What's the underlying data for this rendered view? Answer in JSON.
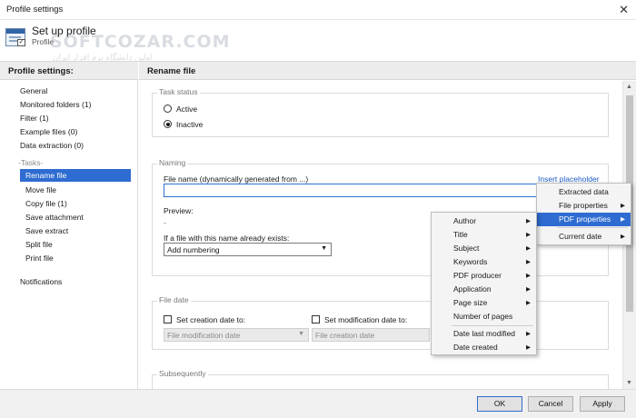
{
  "window": {
    "title": "Profile settings",
    "close_glyph": "✕"
  },
  "header": {
    "title": "Set up profile",
    "subtitle": "Profile",
    "watermark": "SOFTCOZAR.COM",
    "watermark_sub": "اولین دانشگاه نرم افزار ایران"
  },
  "sidebar": {
    "title": "Profile settings:",
    "items": [
      "General",
      "Monitored folders (1)",
      "Filter (1)",
      "Example files (0)",
      "Data extraction (0)"
    ],
    "tasks_label": "-Tasks-",
    "tasks": [
      "Rename file",
      "Move file",
      "Copy file (1)",
      "Save attachment",
      "Save extract",
      "Split file",
      "Print file"
    ],
    "notifications": "Notifications"
  },
  "content": {
    "title": "Rename file",
    "task_status": {
      "label": "Task status",
      "active": "Active",
      "inactive": "Inactive",
      "selected": "Inactive"
    },
    "naming": {
      "label": "Naming",
      "filename_label": "File name (dynamically generated from ...)",
      "filename_value": "",
      "insert_placeholder": "Insert placeholder",
      "preview_label": "Preview:",
      "preview_value": "-",
      "exists_label": "If a file with this name already exists:",
      "exists_value": "Add numbering"
    },
    "file_date": {
      "label": "File date",
      "set_creation": "Set creation date to:",
      "set_modification": "Set modification date to:",
      "creation_source": "File modification date",
      "modification_source": "File creation date"
    },
    "subsequently": {
      "label": "Subsequently"
    }
  },
  "menus": {
    "placeholder": [
      "Extracted data",
      "File properties",
      "PDF properties",
      "Current date"
    ],
    "placeholder_highlight": "PDF properties",
    "pdf_properties": [
      "Author",
      "Title",
      "Subject",
      "Keywords",
      "PDF producer",
      "Application",
      "Page size",
      "Number of pages",
      "Date last modified",
      "Date created"
    ]
  },
  "footer": {
    "ok": "OK",
    "cancel": "Cancel",
    "apply": "Apply"
  },
  "colors": {
    "accent": "#2e6cd1",
    "link": "#1c5bc5"
  },
  "icons": {
    "submenu": "▶",
    "dropdown": "▼",
    "check": "✓"
  }
}
